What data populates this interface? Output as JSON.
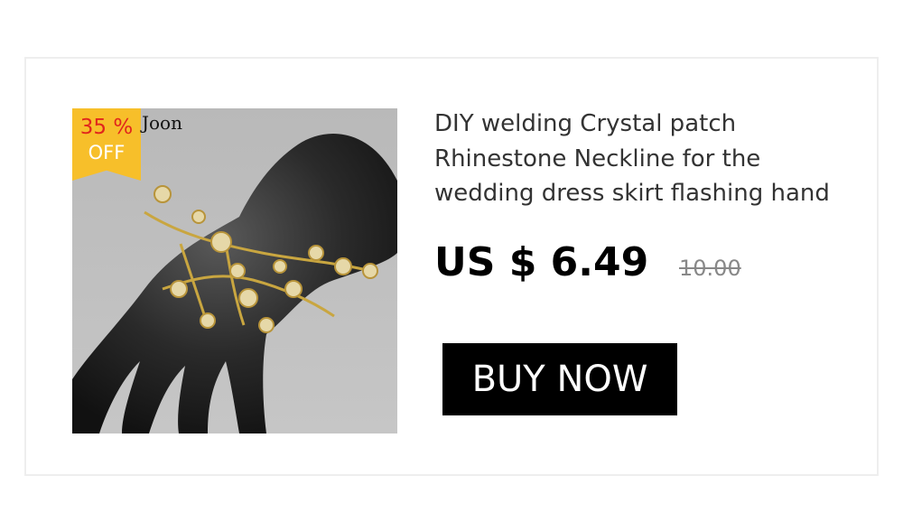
{
  "product": {
    "title": "DIY welding Crystal patch Rhinestone Neckline for the wedding dress skirt flashing hand",
    "price": "US $ 6.49",
    "old_price": "10.00",
    "image_alt": "Rhinestone crystal hand piece on black mannequin hand"
  },
  "badge": {
    "percent": "35 %",
    "off": "OFF",
    "color": "#f7bf2a",
    "percent_color": "#e1261c"
  },
  "brand": {
    "logo_text": "Joon"
  },
  "cta": {
    "label": "BUY NOW",
    "background": "#000000",
    "color": "#ffffff"
  }
}
